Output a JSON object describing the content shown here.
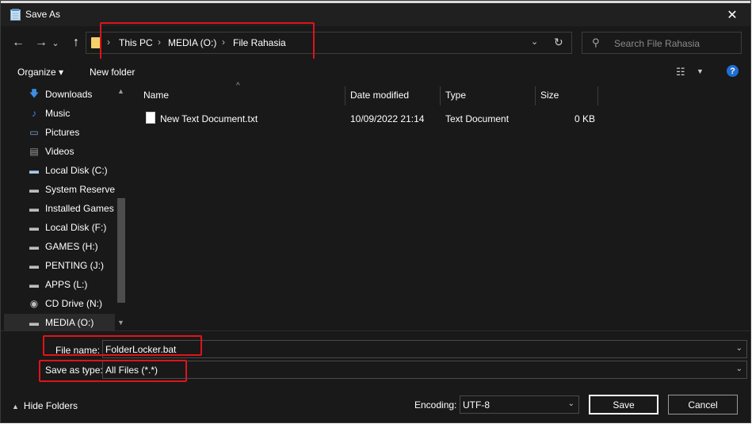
{
  "window": {
    "title": "Save As",
    "close_glyph": "✕"
  },
  "nav": {
    "back_glyph": "←",
    "forward_glyph": "→",
    "recent_glyph": "⌄",
    "up_glyph": "↑",
    "breadcrumbs": [
      "This PC",
      "MEDIA (O:)",
      "File Rahasia"
    ],
    "breadcrumb_sep": "›",
    "dropdown_glyph": "⌄",
    "refresh_glyph": "↻",
    "search_placeholder": "Search File Rahasia",
    "search_glyph": "⚲"
  },
  "toolbar": {
    "organize": "Organize ▾",
    "new_folder": "New folder",
    "view_glyph": "☷",
    "view_dd_glyph": "▼",
    "help": "?"
  },
  "sidebar": {
    "items": [
      {
        "label": "Downloads",
        "icon": "download-arrow-icon",
        "glyph": "🡇",
        "color": "#3a8ee6"
      },
      {
        "label": "Music",
        "icon": "music-note-icon",
        "glyph": "♪",
        "color": "#3a8ee6"
      },
      {
        "label": "Pictures",
        "icon": "pictures-icon",
        "glyph": "▭",
        "color": "#7aa7d8"
      },
      {
        "label": "Videos",
        "icon": "videos-icon",
        "glyph": "▤",
        "color": "#9a9a9a"
      },
      {
        "label": "Local Disk (C:)",
        "icon": "windows-drive-icon",
        "glyph": "▬",
        "color": "#a9c7e8"
      },
      {
        "label": "System Reserved",
        "icon": "drive-icon",
        "glyph": "▬",
        "color": "#bdbdbd"
      },
      {
        "label": "Installed Games",
        "icon": "drive-icon",
        "glyph": "▬",
        "color": "#bdbdbd"
      },
      {
        "label": "Local Disk (F:)",
        "icon": "drive-icon",
        "glyph": "▬",
        "color": "#bdbdbd"
      },
      {
        "label": "GAMES (H:)",
        "icon": "drive-icon",
        "glyph": "▬",
        "color": "#bdbdbd"
      },
      {
        "label": "PENTING (J:)",
        "icon": "drive-icon",
        "glyph": "▬",
        "color": "#bdbdbd"
      },
      {
        "label": "APPS (L:)",
        "icon": "drive-icon",
        "glyph": "▬",
        "color": "#bdbdbd"
      },
      {
        "label": "CD Drive (N:)",
        "icon": "cd-drive-icon",
        "glyph": "◉",
        "color": "#bdbdbd"
      },
      {
        "label": "MEDIA (O:)",
        "icon": "drive-icon",
        "glyph": "▬",
        "color": "#bdbdbd",
        "selected": true
      }
    ],
    "scroll_up_glyph": "▲",
    "scroll_down_glyph": "▼"
  },
  "filelist": {
    "sort_glyph": "^",
    "columns": [
      "Name",
      "Date modified",
      "Type",
      "Size"
    ],
    "rows": [
      {
        "name": "New Text Document.txt",
        "date": "10/09/2022 21:14",
        "type": "Text Document",
        "size": "0 KB"
      }
    ]
  },
  "form": {
    "filename_label": "File name:",
    "filename_value": "FolderLocker.bat",
    "savetype_label": "Save as type:",
    "savetype_value": "All Files  (*.*)",
    "dd_glyph": "⌄",
    "encoding_label": "Encoding:",
    "encoding_value": "UTF-8",
    "save": "Save",
    "cancel": "Cancel",
    "hide_folders": "Hide Folders",
    "hide_glyph": "▲"
  },
  "colors": {
    "highlight": "#e0131a",
    "accent": "#1f6fd1",
    "background": "#191919"
  }
}
